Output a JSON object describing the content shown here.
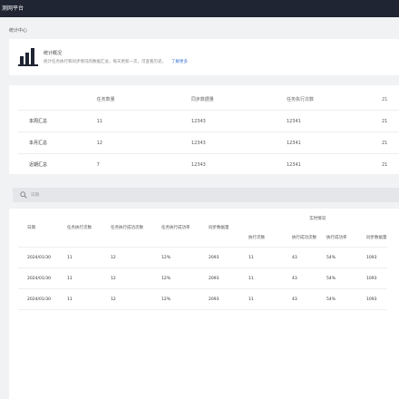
{
  "header": {
    "title": "测网平台"
  },
  "breadcrumb": "统计中心",
  "overview": {
    "title": "统计概况",
    "description": "统计任务执行和同步情况的数据汇总，每天更新一次，可查看历史。",
    "link": "了解更多"
  },
  "summary": {
    "columns": [
      "",
      "任务数量",
      "同步数据量",
      "任务执行次数",
      "21"
    ],
    "rows": [
      [
        "本周汇总",
        "11",
        "12343",
        "12341",
        "21"
      ],
      [
        "本月汇总",
        "12",
        "12343",
        "12341",
        "21"
      ],
      [
        "近期汇总",
        "7",
        "12343",
        "12341",
        "21"
      ]
    ]
  },
  "search": {
    "placeholder": "日期"
  },
  "detail": {
    "group_header": "实时情况",
    "columns_top": [
      "日期",
      "任务执行次数",
      "任务执行成功次数",
      "任务执行成功率",
      "同步数据量"
    ],
    "columns_sub": [
      "执行次数",
      "执行成功次数",
      "执行成功率",
      "同步数据量"
    ],
    "rows": [
      [
        "2024/01/30",
        "11",
        "12",
        "12%",
        "2093",
        "11",
        "43",
        "54%",
        "1093"
      ],
      [
        "2024/01/30",
        "11",
        "12",
        "12%",
        "2093",
        "11",
        "43",
        "54%",
        "1093"
      ],
      [
        "2024/01/30",
        "11",
        "12",
        "12%",
        "2093",
        "11",
        "43",
        "54%",
        "1093"
      ]
    ]
  }
}
